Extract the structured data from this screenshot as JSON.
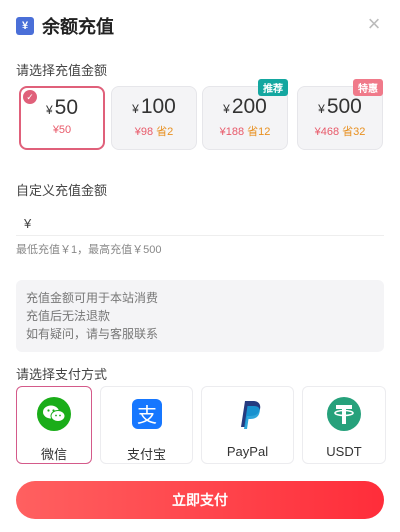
{
  "header": {
    "icon_text": "¥",
    "title": "余额充值",
    "close": "×"
  },
  "amount_section": {
    "label": "请选择充值金额"
  },
  "amounts": [
    {
      "yen": "¥",
      "value": "50",
      "price": "¥50",
      "save": "",
      "tag": "",
      "selected": true
    },
    {
      "yen": "¥",
      "value": "100",
      "price": "¥98",
      "save": "省2",
      "tag": "",
      "selected": false
    },
    {
      "yen": "¥",
      "value": "200",
      "price": "¥188",
      "save": "省12",
      "tag": "推荐",
      "selected": false
    },
    {
      "yen": "¥",
      "value": "500",
      "price": "¥468",
      "save": "省32",
      "tag": "特惠",
      "selected": false
    }
  ],
  "custom": {
    "label": "自定义充值金额",
    "prefix": "¥",
    "value": "",
    "hint": "最低充值￥1，最高充值￥500"
  },
  "notice": {
    "lines": [
      "充值金额可用于本站消费",
      "充值后无法退款",
      "如有疑问，请与客服联系"
    ]
  },
  "payment_section": {
    "label": "请选择支付方式"
  },
  "payments": [
    {
      "label": "微信",
      "icon": "wechat-icon",
      "selected": true
    },
    {
      "label": "支付宝",
      "icon": "alipay-icon",
      "selected": false
    },
    {
      "label": "PayPal",
      "icon": "paypal-icon",
      "selected": false
    },
    {
      "label": "USDT",
      "icon": "usdt-icon",
      "selected": false
    }
  ],
  "pay_button": {
    "label": "立即支付"
  },
  "colors": {
    "accent": "#e0607a",
    "button_start": "#ff6060",
    "button_end": "#ff2d3a",
    "recommend_tag": "#14a7a0",
    "special_tag": "#f07a8a",
    "wechat": "#1aad19",
    "alipay": "#1677ff",
    "paypal": "#253b80",
    "usdt": "#26a17b"
  }
}
